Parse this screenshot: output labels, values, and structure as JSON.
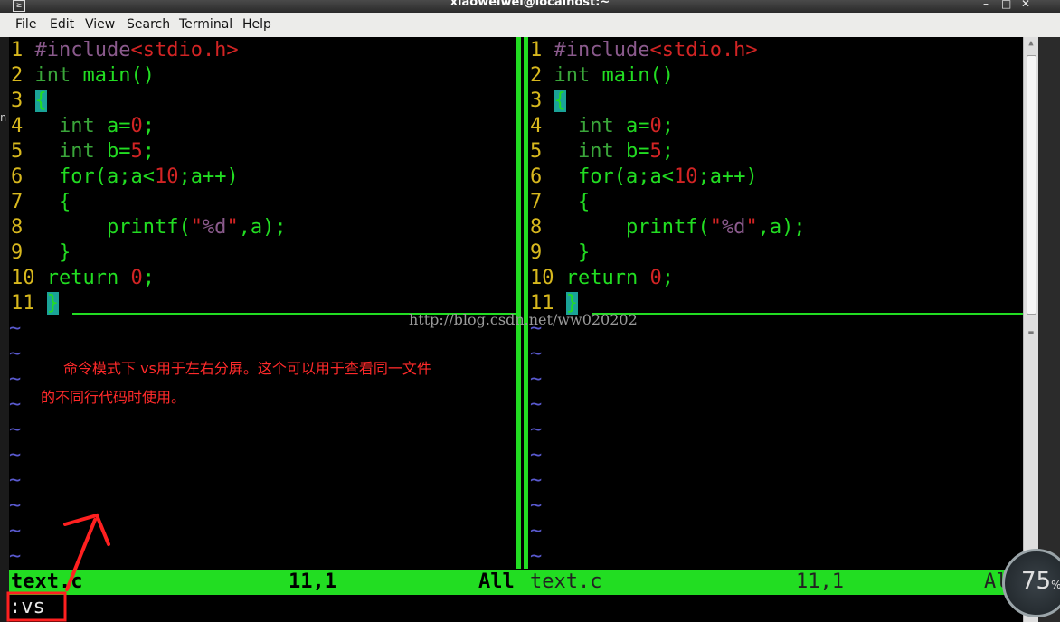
{
  "window": {
    "title": "xiaoweiwei@localhost:~"
  },
  "menu": [
    "File",
    "Edit",
    "View",
    "Search",
    "Terminal",
    "Help"
  ],
  "left_pane": {
    "lines": [
      {
        "n": "1"
      },
      {
        "n": "2"
      },
      {
        "n": "3"
      },
      {
        "n": "4"
      },
      {
        "n": "5"
      },
      {
        "n": "6"
      },
      {
        "n": "7"
      },
      {
        "n": "8"
      },
      {
        "n": "9"
      },
      {
        "n": "10"
      },
      {
        "n": "11"
      }
    ]
  },
  "code": {
    "include": "#include",
    "header": "<stdio.h>",
    "int": "int",
    "main": " main()",
    "open": "{",
    "close": "}",
    "a": " a=",
    "b": " b=",
    "zero": "0",
    "five": "5",
    "semi": ";",
    "for": "for(a;a<",
    "ten": "10",
    "for_end": ";a++)",
    "printf": "printf(",
    "q": "\"",
    "fmt": "%d",
    "printf_end": ",a);",
    "return": "return ",
    "tilde": "~"
  },
  "status": {
    "left_file": "text.c",
    "left_pos": "11,1",
    "left_all": "All",
    "right_file": "text.c",
    "right_pos": "11,1",
    "right_all": "All"
  },
  "command": ":vs",
  "annotation": {
    "line1": "命令模式下 vs用于左右分屏。这个可以用于查看同一文件",
    "line2": "的不同行代码时使用。"
  },
  "watermark": "http://blog.csdn.net/ww020202",
  "gauge": {
    "value": "75",
    "unit": "%"
  },
  "colors": {
    "vim_green": "#22dd22",
    "line_number": "#d8b81e",
    "string_red": "#d22424",
    "annotation_red": "#ff2a2a"
  }
}
